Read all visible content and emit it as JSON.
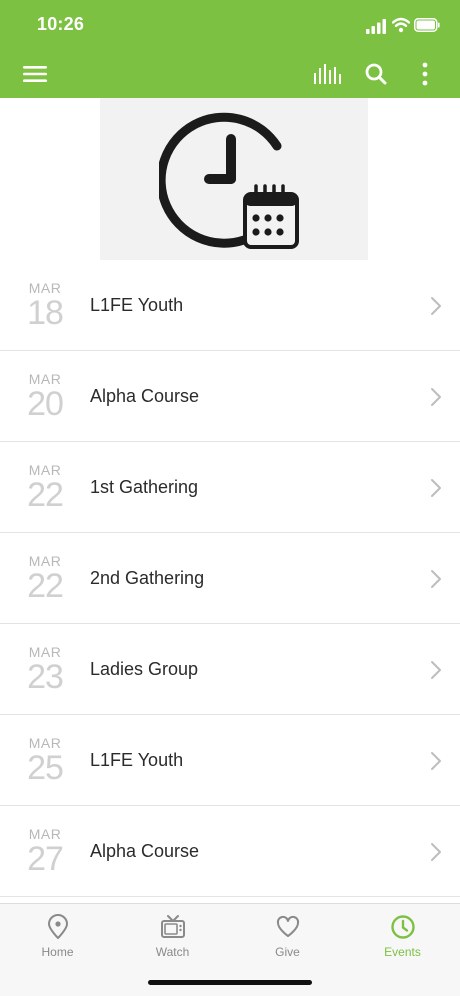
{
  "status_bar": {
    "time": "10:26"
  },
  "toolbar": {
    "icons": [
      "menu-icon",
      "audio-bars-icon",
      "search-icon",
      "more-vertical-icon"
    ]
  },
  "hero": {
    "icon": "clock-calendar-icon"
  },
  "events": [
    {
      "month": "MAR",
      "day": "18",
      "title": "L1FE Youth"
    },
    {
      "month": "MAR",
      "day": "20",
      "title": "Alpha Course"
    },
    {
      "month": "MAR",
      "day": "22",
      "title": "1st Gathering"
    },
    {
      "month": "MAR",
      "day": "22",
      "title": "2nd Gathering"
    },
    {
      "month": "MAR",
      "day": "23",
      "title": "Ladies Group"
    },
    {
      "month": "MAR",
      "day": "25",
      "title": "L1FE Youth"
    },
    {
      "month": "MAR",
      "day": "27",
      "title": "Alpha Course"
    }
  ],
  "tabbar": {
    "tabs": [
      {
        "label": "Home",
        "icon": "map-pin-icon"
      },
      {
        "label": "Watch",
        "icon": "tv-icon"
      },
      {
        "label": "Give",
        "icon": "heart-icon"
      },
      {
        "label": "Events",
        "icon": "clock-icon"
      }
    ],
    "active": "Events"
  },
  "colors": {
    "brand_green": "#7dc143",
    "tab_inactive": "#8a8a8a",
    "date_gray": "#c8c8c8"
  }
}
